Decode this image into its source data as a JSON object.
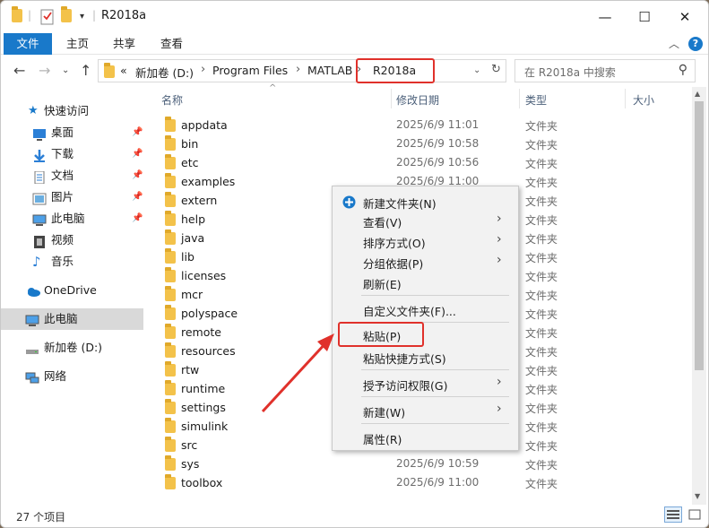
{
  "window": {
    "title": "R2018a",
    "minimize": "—",
    "maximize": "☐",
    "close": "✕"
  },
  "ribbon": {
    "tabs": [
      "文件",
      "主页",
      "共享",
      "查看"
    ],
    "help": "?"
  },
  "nav": {
    "breadcrumb": [
      "新加卷 (D:)",
      "Program Files",
      "MATLAB",
      "R2018a"
    ],
    "overflow": "«",
    "search_placeholder": "在 R2018a 中搜索"
  },
  "sidebar": {
    "quick_access": "快速访问",
    "pinned": [
      {
        "label": "桌面",
        "icon": "desktop-icon"
      },
      {
        "label": "下载",
        "icon": "download-icon"
      },
      {
        "label": "文档",
        "icon": "document-icon"
      },
      {
        "label": "图片",
        "icon": "pictures-icon"
      },
      {
        "label": "此电脑",
        "icon": "computer-icon"
      }
    ],
    "others": [
      {
        "label": "视频",
        "icon": "video-icon"
      },
      {
        "label": "音乐",
        "icon": "music-icon"
      }
    ],
    "onedrive": "OneDrive",
    "this_pc": "此电脑",
    "drive": "新加卷 (D:)",
    "network": "网络"
  },
  "columns": {
    "name": "名称",
    "modified": "修改日期",
    "type": "类型",
    "size": "大小"
  },
  "files": [
    {
      "name": "appdata",
      "date": "2025/6/9 11:01",
      "type": "文件夹"
    },
    {
      "name": "bin",
      "date": "2025/6/9 10:58",
      "type": "文件夹"
    },
    {
      "name": "etc",
      "date": "2025/6/9 10:56",
      "type": "文件夹"
    },
    {
      "name": "examples",
      "date": "2025/6/9 11:00",
      "type": "文件夹"
    },
    {
      "name": "extern",
      "date": "",
      "type": "文件夹"
    },
    {
      "name": "help",
      "date": "",
      "type": "文件夹"
    },
    {
      "name": "java",
      "date": "",
      "type": "文件夹"
    },
    {
      "name": "lib",
      "date": "",
      "type": "文件夹"
    },
    {
      "name": "licenses",
      "date": "",
      "type": "文件夹"
    },
    {
      "name": "mcr",
      "date": "",
      "type": "文件夹"
    },
    {
      "name": "polyspace",
      "date": "",
      "type": "文件夹"
    },
    {
      "name": "remote",
      "date": "",
      "type": "文件夹"
    },
    {
      "name": "resources",
      "date": "",
      "type": "文件夹"
    },
    {
      "name": "rtw",
      "date": "",
      "type": "文件夹"
    },
    {
      "name": "runtime",
      "date": "",
      "type": "文件夹"
    },
    {
      "name": "settings",
      "date": "",
      "type": "文件夹"
    },
    {
      "name": "simulink",
      "date": "",
      "type": "文件夹"
    },
    {
      "name": "src",
      "date": "",
      "type": "文件夹"
    },
    {
      "name": "sys",
      "date": "2025/6/9 10:59",
      "type": "文件夹"
    },
    {
      "name": "toolbox",
      "date": "2025/6/9 11:00",
      "type": "文件夹"
    }
  ],
  "status": {
    "count": "27 个项目"
  },
  "context_menu": {
    "items": [
      {
        "label": "新建文件夹(N)",
        "submenu": false
      },
      {
        "label": "查看(V)",
        "submenu": true
      },
      {
        "label": "排序方式(O)",
        "submenu": true
      },
      {
        "label": "分组依据(P)",
        "submenu": true
      },
      {
        "label": "刷新(E)",
        "submenu": false
      },
      {
        "label": "自定义文件夹(F)...",
        "submenu": false
      },
      {
        "label": "粘贴(P)",
        "submenu": false
      },
      {
        "label": "粘贴快捷方式(S)",
        "submenu": false
      },
      {
        "label": "授予访问权限(G)",
        "submenu": true
      },
      {
        "label": "新建(W)",
        "submenu": true
      },
      {
        "label": "属性(R)",
        "submenu": false
      }
    ]
  },
  "colors": {
    "accent": "#1979ca",
    "highlight": "#e0312b",
    "folder": "#f3c24a"
  }
}
